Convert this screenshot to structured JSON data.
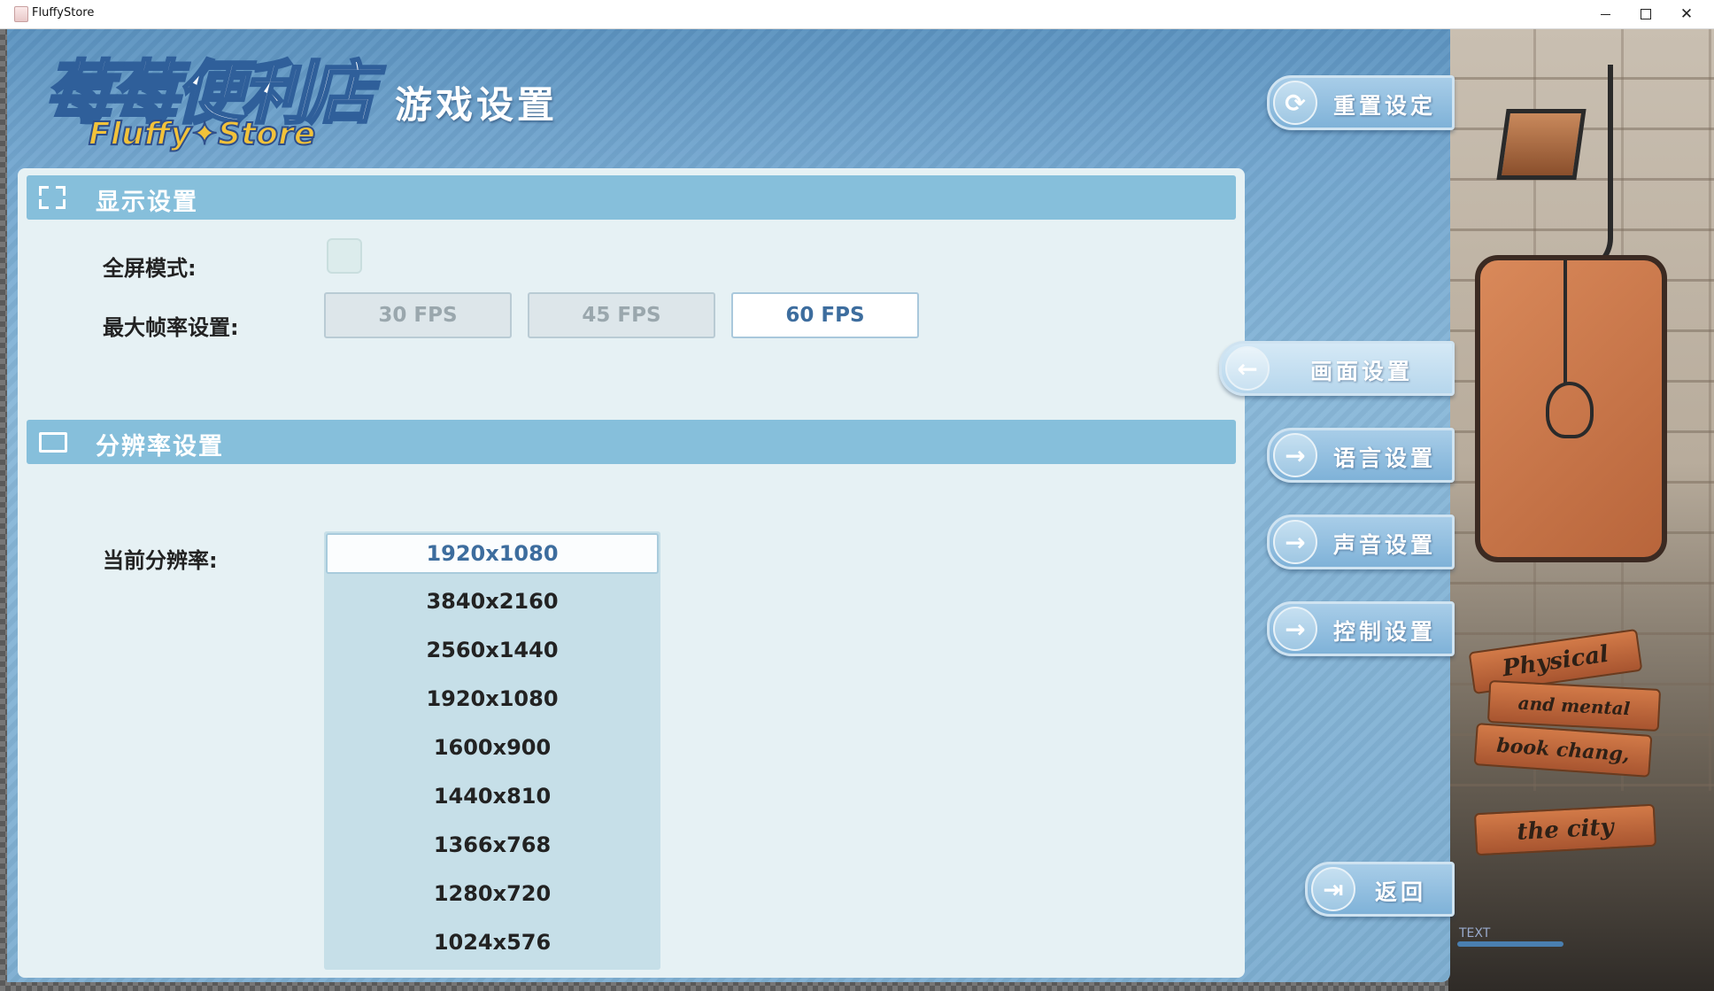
{
  "window": {
    "title": "FluffyStore",
    "controls": {
      "minimize": "minimize-icon",
      "maximize": "maximize-icon",
      "close": "close-icon"
    }
  },
  "header": {
    "logo_cn": "莓莓便利店",
    "logo_en": "Fluffy✦Store",
    "page_title": "游戏设置"
  },
  "display_section": {
    "title": "显示设置",
    "icon": "fullscreen-icon",
    "fullscreen_label": "全屏模式:",
    "fullscreen_checked": false,
    "fps_label": "最大帧率设置:",
    "fps_options": [
      "30 FPS",
      "45 FPS",
      "60 FPS"
    ],
    "fps_selected": "60 FPS"
  },
  "resolution_section": {
    "title": "分辨率设置",
    "icon": "monitor-icon",
    "current_label": "当前分辨率:",
    "current_value": "1920x1080",
    "options": [
      "3840x2160",
      "2560x1440",
      "1920x1080",
      "1600x900",
      "1440x810",
      "1366x768",
      "1280x720",
      "1024x576"
    ]
  },
  "nav": {
    "reset": "重置设定",
    "display": "画面设置",
    "language": "语言设置",
    "sound": "声音设置",
    "control": "控制设置",
    "back": "返回"
  },
  "decor": {
    "sign1": "Physical",
    "sign2": "and mental",
    "sign3": "book chang,",
    "sign4": "the city",
    "text_label": "TEXT"
  },
  "colors": {
    "accent": "#3d6d9e",
    "section_bar": "#86bfdb",
    "panel": "#e6f1f4"
  }
}
